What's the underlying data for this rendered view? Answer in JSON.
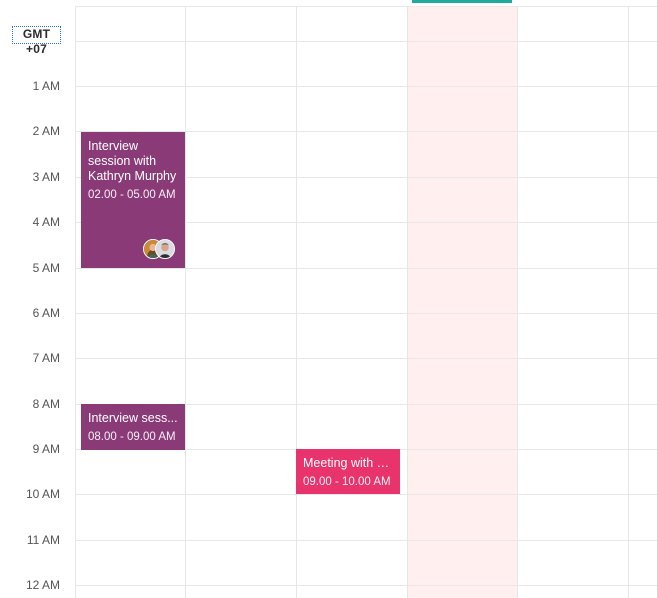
{
  "timezone": "GMT +07",
  "hours": [
    "1 AM",
    "2 AM",
    "3 AM",
    "4 AM",
    "5 AM",
    "6 AM",
    "7 AM",
    "8 AM",
    "9 AM",
    "10 AM",
    "11 AM",
    "12 AM"
  ],
  "events": [
    {
      "title_lines": [
        "Interview",
        "session with",
        "Kathryn Murphy"
      ],
      "time": "02.00 - 05.00 AM",
      "attendee_avatars": [
        "avatar-female",
        "avatar-male"
      ]
    },
    {
      "title": "Interview sess...",
      "time": "08.00 - 09.00 AM"
    },
    {
      "title": "Meeting with s...",
      "time": "09.00 - 10.00 AM"
    }
  ],
  "colors": {
    "accent": "#1fa99a",
    "today_bg": "#fff0ef",
    "event_purple": "#8b3a78",
    "event_pink": "#e8336d",
    "focus_outline": "#1a73e8"
  }
}
